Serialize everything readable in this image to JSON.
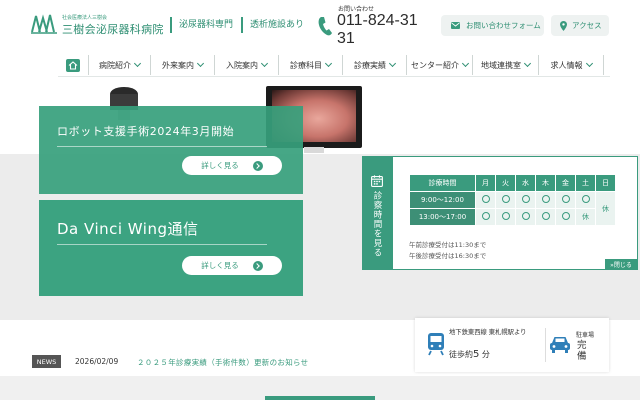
{
  "header": {
    "logo_sub": "社会医療法人三樹会",
    "logo_name": "三樹会泌尿器科病院",
    "tag1": "泌尿器科専門",
    "tag2": "透析施設あり",
    "phone_caption": "お問い合わせ",
    "phone_number": "011-824-3131",
    "contact_label": "お問い合わせフォーム",
    "access_label": "アクセス",
    "icons": {
      "phone": "phone-icon",
      "mail": "mail-icon",
      "pin": "map-pin-icon"
    }
  },
  "nav": {
    "items": [
      {
        "label": "病院紹介"
      },
      {
        "label": "外来案内"
      },
      {
        "label": "入院案内"
      },
      {
        "label": "診療科目"
      },
      {
        "label": "診療実績"
      },
      {
        "label": "センター紹介"
      },
      {
        "label": "地域連携室"
      },
      {
        "label": "求人情報"
      }
    ]
  },
  "hero": {
    "card1": {
      "title": "ロボット支援手術2024年3月開始",
      "button": "詳しく見る"
    },
    "card2": {
      "title": "Da Vinci Wing通信",
      "button": "詳しく見る"
    }
  },
  "schedule": {
    "tab_label": "診察時間を見る",
    "header": [
      "診療時間",
      "月",
      "火",
      "水",
      "木",
      "金",
      "土",
      "日"
    ],
    "rows": [
      {
        "time": "9:00～12:00"
      },
      {
        "time": "13:00～17:00",
        "sat": "休"
      }
    ],
    "sun": "休",
    "note1": "午前診療受付は11:30まで",
    "note2": "午後診療受付は16:30まで",
    "close": "»閉じる"
  },
  "access": {
    "station": "地下鉄東西線 東札幌駅より",
    "walk_prefix": "徒歩約",
    "walk_num": "5",
    "walk_unit": "分",
    "parking_label": "駐車場",
    "parking_value": "完備"
  },
  "news": {
    "badge": "NEWS",
    "date": "2026/02/09",
    "title": "２０２５年診療実績（手術件数）更新のお知らせ"
  },
  "colors": {
    "brand": "#3a9b7e",
    "dark_green": "#3d8f76"
  }
}
